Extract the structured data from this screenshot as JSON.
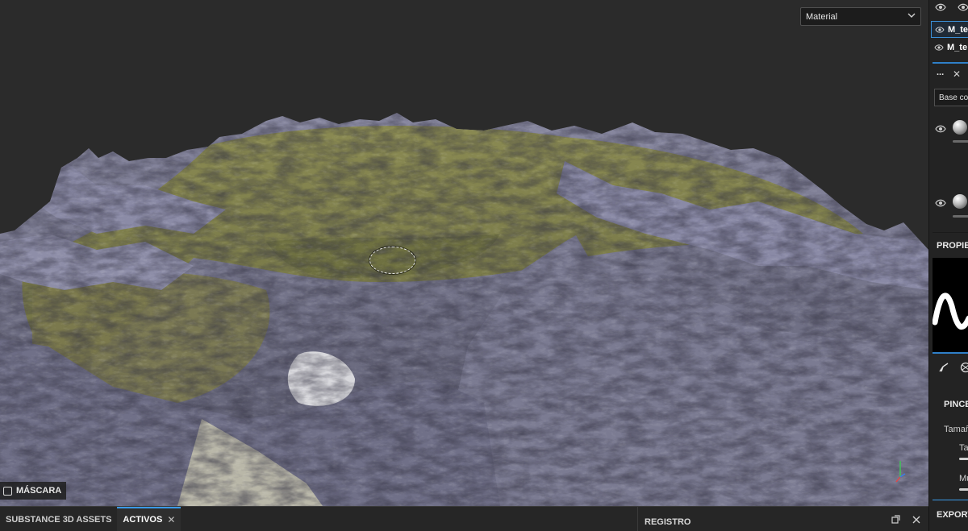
{
  "viewport": {
    "mode_select": {
      "value": "Material",
      "icon": "chevron-down-icon"
    },
    "mask_label": "MÁSCARA",
    "gizmo_icon": "axis-gizmo-icon"
  },
  "bottom_bar": {
    "tabs": [
      {
        "label": "SUBSTANCE 3D ASSETS",
        "active": false
      },
      {
        "label": "ACTIVOS",
        "active": true,
        "close_icon": "✕"
      }
    ],
    "log_panel": {
      "title": "REGISTRO",
      "maximize_icon": "maximize-icon",
      "close_icon": "close-icon"
    }
  },
  "right_panel": {
    "visibility_icons": [
      "eye-settings-icon",
      "eye-icon"
    ],
    "layers": [
      {
        "name": "M_te",
        "selected": true
      },
      {
        "name": "M_te",
        "selected": false
      }
    ],
    "panel_header": {
      "menu": "...",
      "close": "✕"
    },
    "channel_select": "Base co",
    "properties_title": "PROPIED",
    "tool_tabs": [
      "brush-icon",
      "material-ball-icon"
    ],
    "brush_section": "PINCEL",
    "size_label": "Tamañ",
    "size_sub_label": "Ta",
    "flow_label": "Mu",
    "export_label": "EXPORTA"
  },
  "colors": {
    "accent": "#3b9ae8",
    "viewport_bg": "#2b2b2b",
    "panel_bg": "#232323"
  }
}
